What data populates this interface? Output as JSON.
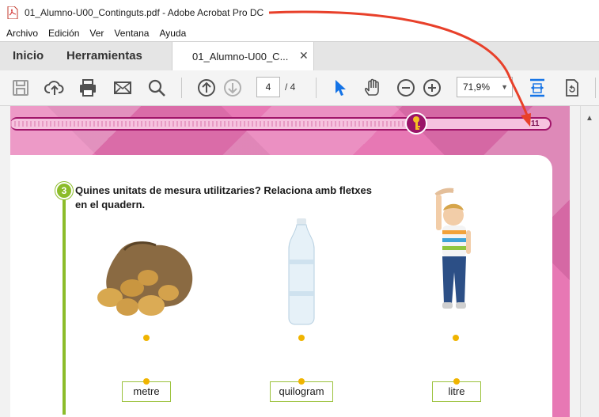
{
  "window": {
    "title": "01_Alumno-U00_Continguts.pdf - Adobe Acrobat Pro DC"
  },
  "menu": [
    "Archivo",
    "Edición",
    "Ver",
    "Ventana",
    "Ayuda"
  ],
  "tabs": {
    "home": "Inicio",
    "tools": "Herramientas",
    "document": "01_Alumno-U00_C...",
    "close": "✕"
  },
  "toolbar": {
    "current_page": "4",
    "page_total": "/  4",
    "zoom": "71,9%",
    "zoom_arrow": "▼"
  },
  "document": {
    "page_number": "11",
    "question_number": "3",
    "question_text": "Quines unitats de mesura utilitzaries? Relaciona amb fletxes en el quadern.",
    "labels": [
      "metre",
      "quilogram",
      "litre"
    ]
  },
  "colors": {
    "accent": "#1473e6",
    "page_pink": "#e778b4",
    "green": "#8cbc2a",
    "dot": "#f0b400",
    "annotation": "#e8402a"
  }
}
